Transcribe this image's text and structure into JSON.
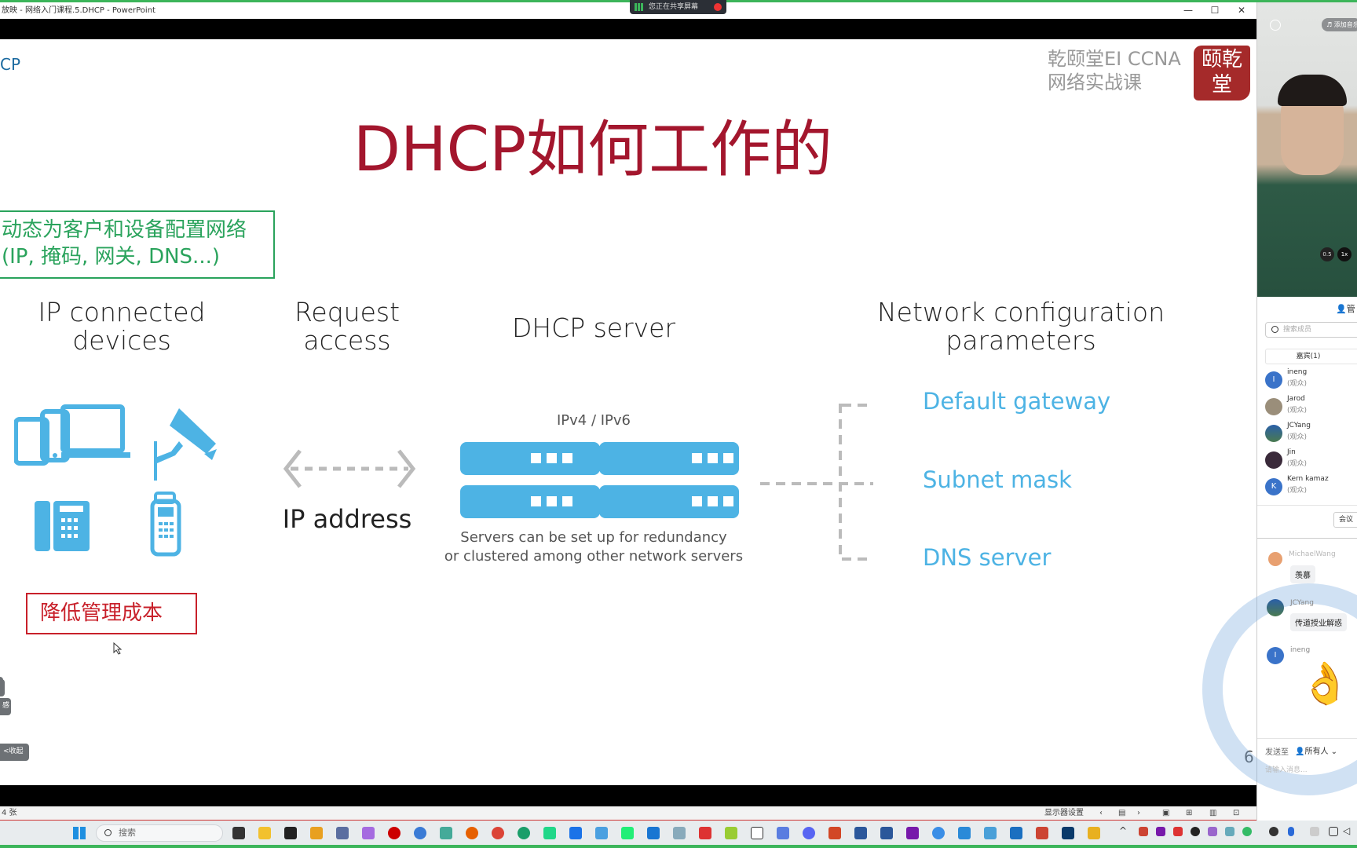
{
  "window": {
    "title": "放映 - 网络入门课程.5.DHCP - PowerPoint",
    "minimize": "—",
    "maximize": "☐",
    "close": "✕"
  },
  "share_bar": {
    "text": "您正在共享屏幕"
  },
  "slide": {
    "corner_title": "CP",
    "brand_line1": "乾颐堂EI CCNA",
    "brand_line2": "网络实战课",
    "seal_text": "颐乾堂",
    "title": "DHCP如何工作的",
    "green_note": "动态为客户和设备配置网络(IP, 掩码, 网关, DNS...)",
    "red_note": "降低管理成本",
    "headers": {
      "devices": "IP connected devices",
      "request": "Request access",
      "server": "DHCP server",
      "params": "Network configuration parameters"
    },
    "ip_address": "IP address",
    "ipver": "IPv4 / IPv6",
    "server_caption_1": "Servers can be set up for redundancy",
    "server_caption_2": "or clustered among other network servers",
    "params": [
      "Default gateway",
      "Subnet mask",
      "DNS server"
    ],
    "page_number": "6",
    "collapse_button": "<收起",
    "side_btn_2": "感",
    "colors": {
      "title": "#a3162d",
      "green": "#2aa35c",
      "red": "#c8202a",
      "blue": "#4db3e4"
    }
  },
  "statusbar": {
    "slide_info": "4 张",
    "display_settings": "显示器设置"
  },
  "taskbar": {
    "search_placeholder": "搜索"
  },
  "panel": {
    "video": {
      "add_music": "添加音乐",
      "speed_05": "0.5",
      "speed_1": "1x"
    },
    "manage_label": "管",
    "search_placeholder": "搜索成员",
    "tab_guests": "嘉宾(1)",
    "members": [
      {
        "name": "ineng",
        "role": "(观众)",
        "initial": "I",
        "color": "#3a73c9"
      },
      {
        "name": "Jarod",
        "role": "(观众)",
        "initial": "",
        "color": "#9a8e7a"
      },
      {
        "name": "JCYang",
        "role": "(观众)",
        "initial": "",
        "color": "#3b74b2"
      },
      {
        "name": "Jin",
        "role": "(观众)",
        "initial": "",
        "color": "#3a2a3a"
      },
      {
        "name": "Kern kamaz",
        "role": "(观众)",
        "initial": "K",
        "color": "#3a73c9"
      }
    ],
    "meeting_button": "会议",
    "chat": [
      {
        "name": "MichaelWang",
        "text": "羡慕"
      },
      {
        "name": "JCYang",
        "text": "传道授业解惑"
      },
      {
        "name": "ineng",
        "text": "👌"
      }
    ],
    "send_to_label": "发送至",
    "send_to_value": "所有人",
    "message_placeholder": "请输入消息..."
  }
}
